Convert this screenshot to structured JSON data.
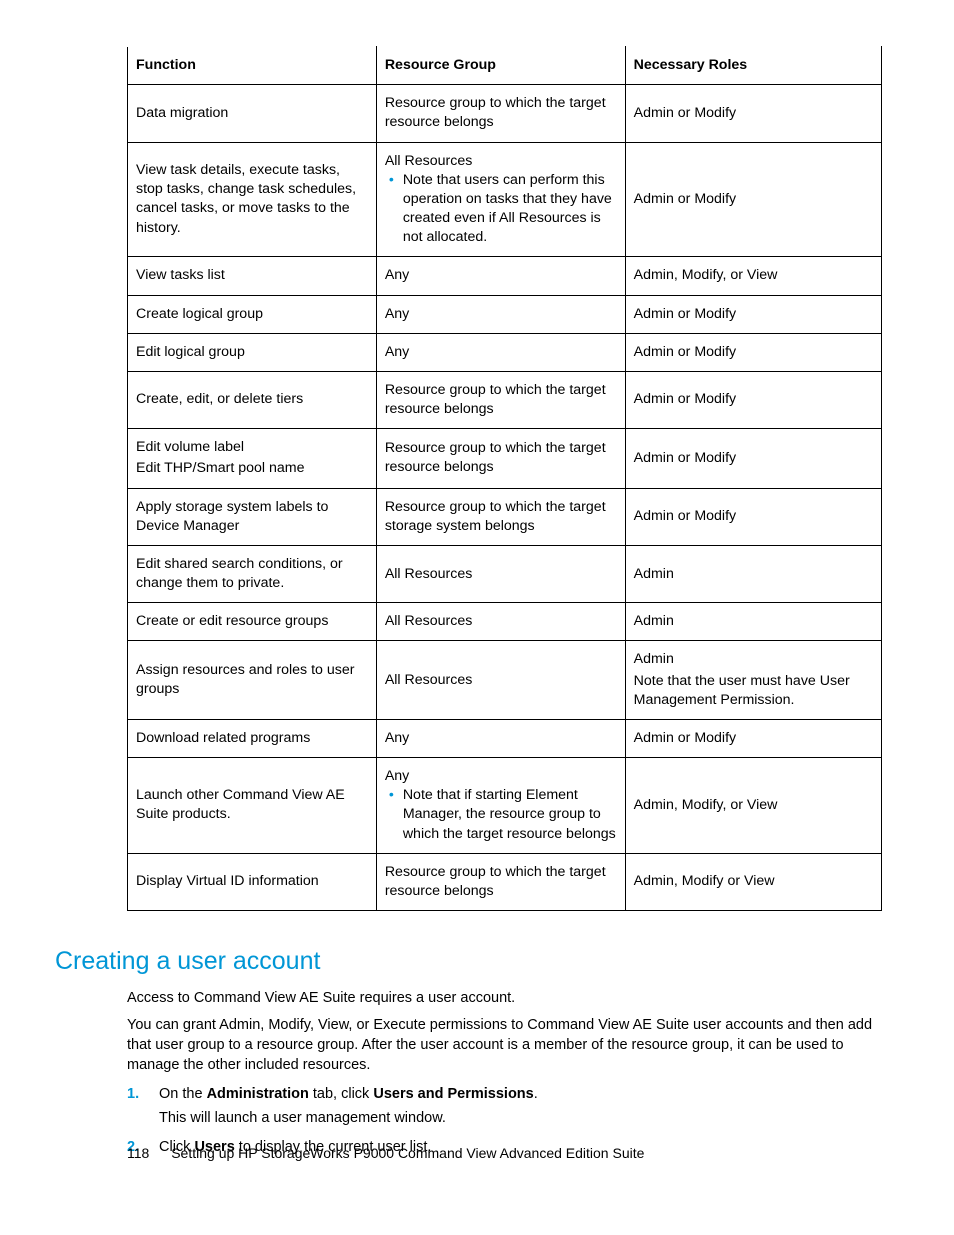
{
  "table": {
    "headers": [
      "Function",
      "Resource Group",
      "Necessary Roles"
    ],
    "rows": [
      {
        "function": "Data migration",
        "resource": "Resource group to which the target resource belongs",
        "roles": "Admin or Modify"
      },
      {
        "function": "View task details, execute tasks, stop tasks, change task schedules, cancel tasks, or move tasks to the history.",
        "resource_lead": "All Resources",
        "resource_note": "Note that users can perform this operation on tasks that they have created even if All Resources is not allocated.",
        "roles": "Admin or Modify"
      },
      {
        "function": "View tasks list",
        "resource": "Any",
        "roles": "Admin, Modify, or View"
      },
      {
        "function": "Create logical group",
        "resource": "Any",
        "roles": "Admin or Modify"
      },
      {
        "function": "Edit logical group",
        "resource": "Any",
        "roles": "Admin or Modify"
      },
      {
        "function": "Create, edit, or delete tiers",
        "resource": "Resource group to which the target resource belongs",
        "roles": "Admin or Modify"
      },
      {
        "function_line1": "Edit volume label",
        "function_line2": "Edit THP/Smart pool name",
        "resource": "Resource group to which the target resource belongs",
        "roles": "Admin or Modify"
      },
      {
        "function": "Apply storage system labels to Device Manager",
        "resource": "Resource group to which the target storage system belongs",
        "roles": "Admin or Modify"
      },
      {
        "function": "Edit shared search conditions, or change them to private.",
        "resource": "All Resources",
        "roles": "Admin"
      },
      {
        "function": "Create or edit resource groups",
        "resource": "All Resources",
        "roles": "Admin"
      },
      {
        "function": "Assign resources and roles to user groups",
        "resource": "All Resources",
        "roles_line1": "Admin",
        "roles_line2": "Note that the user must have User Management Permission."
      },
      {
        "function": "Download related programs",
        "resource": "Any",
        "roles": "Admin or Modify"
      },
      {
        "function": "Launch other Command View AE Suite products.",
        "resource_lead": "Any",
        "resource_note": "Note that if starting Element Manager, the resource group to which the target resource belongs",
        "roles": "Admin, Modify, or View"
      },
      {
        "function": "Display Virtual ID information",
        "resource": "Resource group to which the target resource belongs",
        "roles": "Admin, Modify or View"
      }
    ]
  },
  "section": {
    "heading": "Creating a user account",
    "para1": "Access to Command View AE Suite requires a user account.",
    "para2": "You can grant Admin, Modify, View, or Execute permissions to Command View AE Suite user accounts and then add that user group to a resource group. After the user account is a member of the resource group, it can be used to manage the other included resources.",
    "step1_pre": "On the ",
    "step1_b1": "Administration",
    "step1_mid": " tab, click ",
    "step1_b2": "Users and Permissions",
    "step1_post": ".",
    "step1_sub": "This will launch a user management window.",
    "step2_pre": "Click ",
    "step2_b1": "Users",
    "step2_post": " to display the current user list."
  },
  "footer": {
    "pagenum": "118",
    "title": "Setting up HP StorageWorks P9000 Command View Advanced Edition Suite"
  }
}
